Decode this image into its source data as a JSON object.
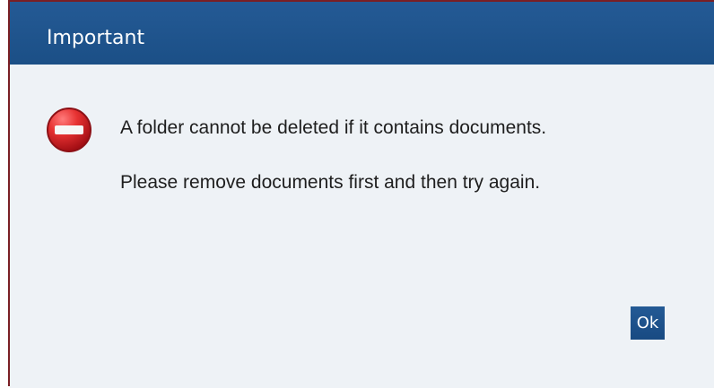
{
  "dialog": {
    "title": "Important",
    "icon": "error-stop-icon",
    "messages": [
      "A folder cannot be deleted if it contains documents.",
      "Please remove documents first and then try again."
    ],
    "ok_label": "Ok"
  },
  "colors": {
    "titlebar": "#1f5591",
    "content_background": "#eef2f6",
    "error_red": "#d72b2b",
    "border": "#7a1f24"
  }
}
